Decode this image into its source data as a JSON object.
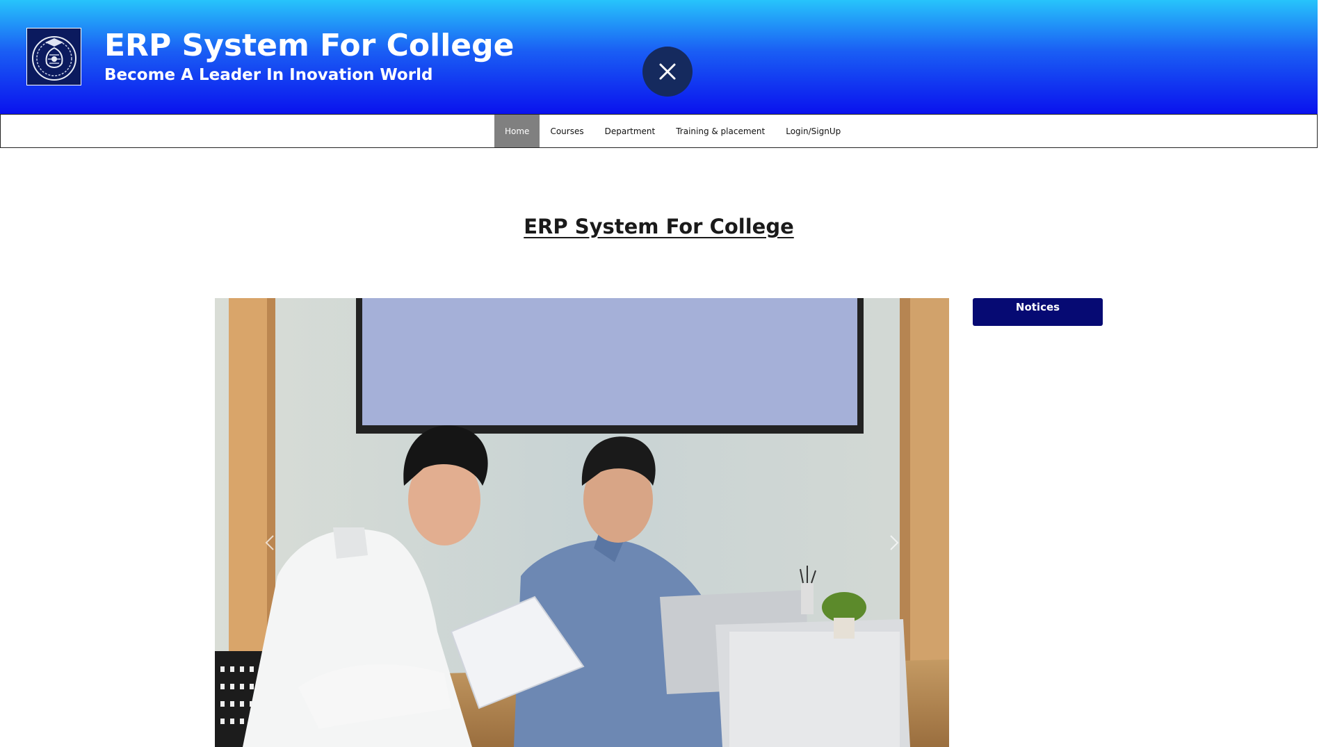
{
  "header": {
    "title": "ERP System For College",
    "tagline": "Become A Leader In Inovation World",
    "logo_icon": "college-emblem-icon",
    "close_icon": "close-icon"
  },
  "nav": {
    "items": [
      {
        "label": "Home",
        "active": true
      },
      {
        "label": "Courses",
        "active": false
      },
      {
        "label": "Department",
        "active": false
      },
      {
        "label": "Training & placement",
        "active": false
      },
      {
        "label": "Login/SignUp",
        "active": false
      }
    ]
  },
  "main": {
    "heading": "ERP System For College"
  },
  "carousel": {
    "image_alt": "",
    "prev_icon": "chevron-left-icon",
    "next_icon": "chevron-right-icon"
  },
  "notices": {
    "title": "Notices"
  },
  "colors": {
    "header_top": "#27c4fb",
    "header_bottom": "#0a12ee",
    "close_button": "#152a5e",
    "nav_active": "#808080",
    "notices_bg": "#060a73"
  }
}
